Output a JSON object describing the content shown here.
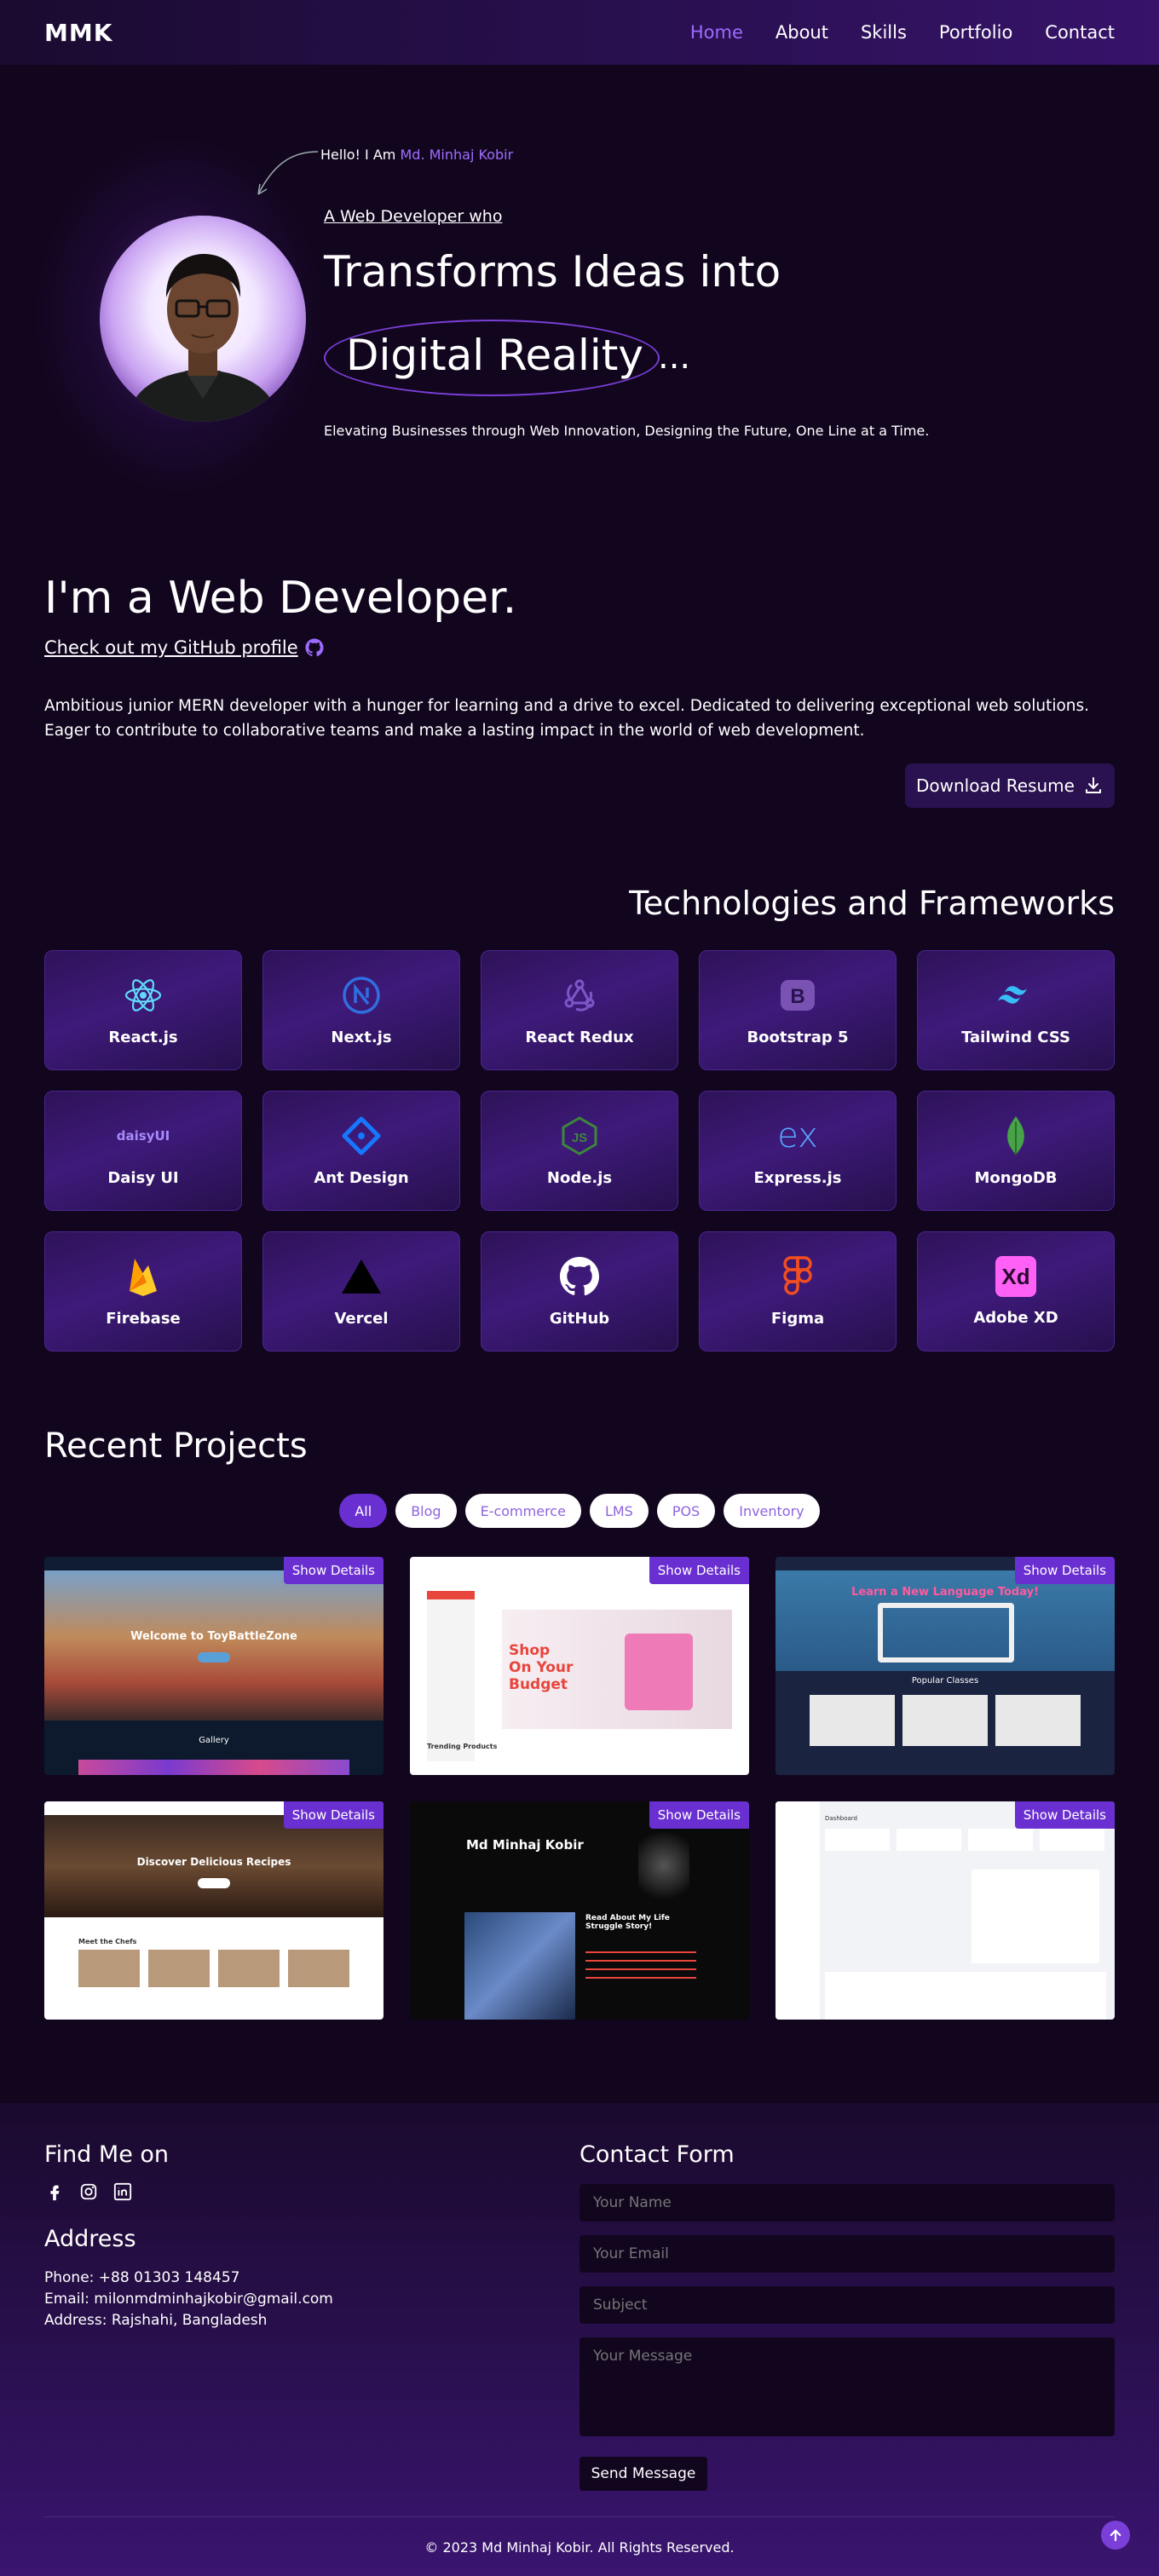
{
  "nav": {
    "logo": "MMK",
    "links": [
      "Home",
      "About",
      "Skills",
      "Portfolio",
      "Contact"
    ],
    "active": "Home"
  },
  "hero": {
    "hello_prefix": "Hello! I Am ",
    "hello_name": "Md. Minhaj Kobir",
    "subtitle": "A Web Developer who",
    "title_line1": "Transforms Ideas into",
    "title_line2": "Digital Reality",
    "title_suffix": "...",
    "tagline": "Elevating Businesses through Web Innovation, Designing the Future, One Line at a Time."
  },
  "about": {
    "title": "I'm a Web Developer.",
    "github_link": "Check out my GitHub profile",
    "description": "Ambitious junior MERN developer with a hunger for learning and a drive to excel. Dedicated to delivering exceptional web solutions. Eager to contribute to collaborative teams and make a lasting impact in the world of web development.",
    "download_label": "Download Resume"
  },
  "tech": {
    "title": "Technologies and Frameworks",
    "items": [
      {
        "label": "React.js",
        "icon": "react-icon",
        "color": "#61dafb"
      },
      {
        "label": "Next.js",
        "icon": "nextjs-icon",
        "color": "#2f6fe0"
      },
      {
        "label": "React Redux",
        "icon": "redux-icon",
        "color": "#764abc"
      },
      {
        "label": "Bootstrap 5",
        "icon": "bootstrap-icon",
        "color": "#7952b3"
      },
      {
        "label": "Tailwind CSS",
        "icon": "tailwind-icon",
        "color": "#38bdf8"
      },
      {
        "label": "Daisy UI",
        "icon": "daisyui-icon",
        "color": "#a78bfa"
      },
      {
        "label": "Ant Design",
        "icon": "antdesign-icon",
        "color": "#1677ff"
      },
      {
        "label": "Node.js",
        "icon": "nodejs-icon",
        "color": "#3c873a"
      },
      {
        "label": "Express.js",
        "icon": "express-icon",
        "color": "#58a6ff"
      },
      {
        "label": "MongoDB",
        "icon": "mongodb-icon",
        "color": "#47a248"
      },
      {
        "label": "Firebase",
        "icon": "firebase-icon",
        "color": "#ffca28"
      },
      {
        "label": "Vercel",
        "icon": "vercel-icon",
        "color": "#000000"
      },
      {
        "label": "GitHub",
        "icon": "github-icon",
        "color": "#ffffff"
      },
      {
        "label": "Figma",
        "icon": "figma-icon",
        "color": "#f24e1e"
      },
      {
        "label": "Adobe XD",
        "icon": "adobexd-icon",
        "color": "#ff61f6"
      }
    ],
    "daisy_text": "daisyUI",
    "express_text": "ex",
    "xd_text": "Xd"
  },
  "projects": {
    "title": "Recent Projects",
    "filters": [
      "All",
      "Blog",
      "E-commerce",
      "LMS",
      "POS",
      "Inventory"
    ],
    "active_filter": "All",
    "button_label": "Show Details",
    "cards": [
      {
        "headline": "Welcome to ToyBattleZone",
        "section": "Gallery"
      },
      {
        "headline": "Shop On Your Budget",
        "section": "Trending Products"
      },
      {
        "headline": "Learn a New Language Today!",
        "section": "Popular Classes"
      },
      {
        "headline": "Discover Delicious Recipes",
        "section": "Meet the Chefs"
      },
      {
        "headline": "Md Minhaj Kobir",
        "section": "Read About My Life Struggle Story!"
      },
      {
        "headline": "Dashboard",
        "section": ""
      }
    ]
  },
  "footer": {
    "find_title": "Find Me on",
    "social_icons": [
      "facebook-icon",
      "instagram-icon",
      "linkedin-icon"
    ],
    "address_title": "Address",
    "phone": "Phone: +88 01303 148457",
    "email": "Email: milonmdminhajkobir@gmail.com",
    "address": "Address: Rajshahi, Bangladesh",
    "contact_title": "Contact Form",
    "name_placeholder": "Your Name",
    "email_placeholder": "Your Email",
    "subject_placeholder": "Subject",
    "message_placeholder": "Your Message",
    "send_label": "Send Message",
    "copyright": "© 2023 Md Minhaj Kobir. All Rights Reserved."
  }
}
